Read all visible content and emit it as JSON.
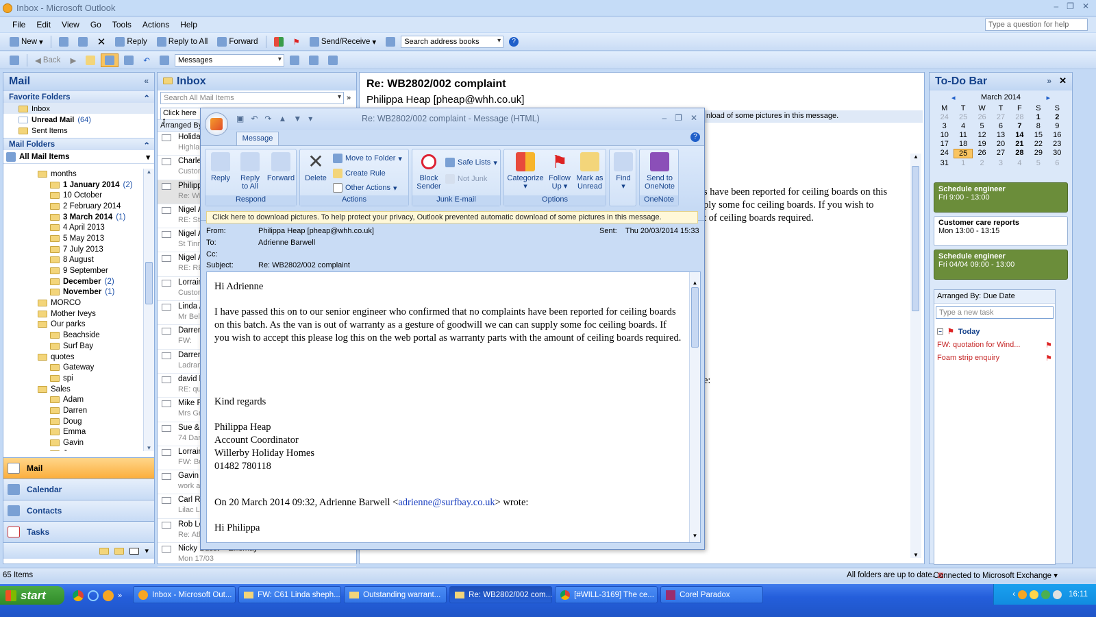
{
  "window": {
    "title": "Inbox - Microsoft Outlook",
    "help_placeholder": "Type a question for help"
  },
  "menu": [
    "File",
    "Edit",
    "View",
    "Go",
    "Tools",
    "Actions",
    "Help"
  ],
  "toolbar1": {
    "new": "New",
    "reply": "Reply",
    "reply_all": "Reply to All",
    "forward": "Forward",
    "send_receive": "Send/Receive",
    "search_address": "Search address books"
  },
  "toolbar2": {
    "back": "Back",
    "view_combo": "Messages"
  },
  "nav": {
    "title": "Mail",
    "favorites_header": "Favorite Folders",
    "favorites": [
      {
        "label": "Inbox",
        "count": ""
      },
      {
        "label": "Unread Mail",
        "count": "(64)"
      },
      {
        "label": "Sent Items",
        "count": ""
      }
    ],
    "mail_folders_header": "Mail Folders",
    "all_mail": "All Mail Items",
    "tree": [
      {
        "label": "months",
        "count": "",
        "indent": 1,
        "bold": false
      },
      {
        "label": "1 January 2014",
        "count": "(2)",
        "indent": 2,
        "bold": true
      },
      {
        "label": "10 October",
        "count": "",
        "indent": 2,
        "bold": false
      },
      {
        "label": "2 February 2014",
        "count": "",
        "indent": 2,
        "bold": false
      },
      {
        "label": "3 March 2014",
        "count": "(1)",
        "indent": 2,
        "bold": true
      },
      {
        "label": "4 April 2013",
        "count": "",
        "indent": 2,
        "bold": false
      },
      {
        "label": "5 May 2013",
        "count": "",
        "indent": 2,
        "bold": false
      },
      {
        "label": "7 July 2013",
        "count": "",
        "indent": 2,
        "bold": false
      },
      {
        "label": "8 August",
        "count": "",
        "indent": 2,
        "bold": false
      },
      {
        "label": "9 September",
        "count": "",
        "indent": 2,
        "bold": false
      },
      {
        "label": "December",
        "count": "(2)",
        "indent": 2,
        "bold": true
      },
      {
        "label": "November",
        "count": "(1)",
        "indent": 2,
        "bold": true
      },
      {
        "label": "MORCO",
        "count": "",
        "indent": 1,
        "bold": false
      },
      {
        "label": "Mother Iveys",
        "count": "",
        "indent": 1,
        "bold": false
      },
      {
        "label": "Our parks",
        "count": "",
        "indent": 1,
        "bold": false
      },
      {
        "label": "Beachside",
        "count": "",
        "indent": 2,
        "bold": false
      },
      {
        "label": "Surf Bay",
        "count": "",
        "indent": 2,
        "bold": false
      },
      {
        "label": "quotes",
        "count": "",
        "indent": 1,
        "bold": false
      },
      {
        "label": "Gateway",
        "count": "",
        "indent": 2,
        "bold": false
      },
      {
        "label": "spi",
        "count": "",
        "indent": 2,
        "bold": false
      },
      {
        "label": "Sales",
        "count": "",
        "indent": 1,
        "bold": false
      },
      {
        "label": "Adam",
        "count": "",
        "indent": 2,
        "bold": false
      },
      {
        "label": "Darren",
        "count": "",
        "indent": 2,
        "bold": false
      },
      {
        "label": "Doug",
        "count": "",
        "indent": 2,
        "bold": false
      },
      {
        "label": "Emma",
        "count": "",
        "indent": 2,
        "bold": false
      },
      {
        "label": "Gavin",
        "count": "",
        "indent": 2,
        "bold": false
      },
      {
        "label": "Jane",
        "count": "",
        "indent": 2,
        "bold": false
      }
    ],
    "buttons": [
      "Mail",
      "Calendar",
      "Contacts",
      "Tasks"
    ]
  },
  "inbox": {
    "title": "Inbox",
    "search_placeholder": "Search All Mail Items",
    "click_here": "Click here t",
    "arranged": "Arranged By",
    "items": [
      {
        "from": "Holiday",
        "sub": "Highlan"
      },
      {
        "from": "Charlen",
        "sub": "Custom"
      },
      {
        "from": "Philipp",
        "sub": "Re: WB"
      },
      {
        "from": "Nigel A",
        "sub": "RE: St T"
      },
      {
        "from": "Nigel A",
        "sub": "St Tinn"
      },
      {
        "from": "Nigel A",
        "sub": "RE: RE:"
      },
      {
        "from": "Lorrain",
        "sub": "Custom"
      },
      {
        "from": "Linda A",
        "sub": "Mr Bell"
      },
      {
        "from": "Darren",
        "sub": "FW:"
      },
      {
        "from": "Darren",
        "sub": "Ladram"
      },
      {
        "from": "david b",
        "sub": "RE: quo"
      },
      {
        "from": "Mike Fi",
        "sub": "Mrs Gri"
      },
      {
        "from": "Sue &P",
        "sub": "74 Dart"
      },
      {
        "from": "Lorrain",
        "sub": "FW: Bu"
      },
      {
        "from": "Gavin B",
        "sub": "work at"
      },
      {
        "from": "Carl Ro",
        "sub": "Lilac Lo"
      },
      {
        "from": "Rob Lo",
        "sub": "Re: Atla"
      },
      {
        "from": "Nicky Busst ~ Ellismay",
        "sub": "Mon 17/03"
      }
    ]
  },
  "reading": {
    "subject": "Re: WB2802/002 complaint",
    "from": "Philippa Heap [pheap@whh.co.uk]",
    "infobar": "nload of some pictures in this message.",
    "line1": "s have been reported for ceiling boards on this",
    "line2": "ply some foc ceiling boards.  If you wish to",
    "line3": "t of ceiling boards required.",
    "colon": "e:"
  },
  "todo": {
    "title": "To-Do Bar",
    "month": "March 2014",
    "days": [
      "M",
      "T",
      "W",
      "T",
      "F",
      "S",
      "S"
    ],
    "weeks": [
      [
        "24",
        "25",
        "26",
        "27",
        "28",
        "1",
        "2"
      ],
      [
        "3",
        "4",
        "5",
        "6",
        "7",
        "8",
        "9"
      ],
      [
        "10",
        "11",
        "12",
        "13",
        "14",
        "15",
        "16"
      ],
      [
        "17",
        "18",
        "19",
        "20",
        "21",
        "22",
        "23"
      ],
      [
        "24",
        "25",
        "26",
        "27",
        "28",
        "29",
        "30"
      ],
      [
        "31",
        "1",
        "2",
        "3",
        "4",
        "5",
        "6"
      ]
    ],
    "appts": [
      {
        "title": "Schedule engineer",
        "time": "Fri 9:00 - 13:00"
      },
      {
        "title": "Customer care reports",
        "time": "Mon 13:00 - 13:15"
      },
      {
        "title": "Schedule engineer",
        "time": "Fri 04/04 09:00 - 13:00"
      }
    ],
    "arranged": "Arranged By: Due Date",
    "new_task": "Type a new task",
    "today": "Today",
    "tasks": [
      "FW: quotation for Wind...",
      "Foam strip enquiry"
    ]
  },
  "message_window": {
    "title": "Re: WB2802/002 complaint - Message (HTML)",
    "tab": "Message",
    "respond": {
      "reply": "Reply",
      "reply_all_1": "Reply",
      "reply_all_2": "to All",
      "forward": "Forward",
      "label": "Respond"
    },
    "actions": {
      "delete": "Delete",
      "move": "Move to Folder",
      "rule": "Create Rule",
      "other": "Other Actions",
      "label": "Actions"
    },
    "junk": {
      "block_1": "Block",
      "block_2": "Sender",
      "safe": "Safe Lists",
      "not_junk": "Not Junk",
      "label": "Junk E-mail"
    },
    "options": {
      "categorize": "Categorize",
      "follow_1": "Follow",
      "follow_2": "Up",
      "mark_1": "Mark as",
      "mark_2": "Unread",
      "label": "Options"
    },
    "find": "Find",
    "onenote": {
      "send_1": "Send to",
      "send_2": "OneNote",
      "label": "OneNote"
    },
    "infobar": "Click here to download pictures. To help protect your privacy, Outlook prevented automatic download of some pictures in this message.",
    "from_label": "From:",
    "from": "Philippa Heap [pheap@whh.co.uk]",
    "to_label": "To:",
    "to": "Adrienne Barwell",
    "cc_label": "Cc:",
    "subject_label": "Subject:",
    "subject": "Re: WB2802/002 complaint",
    "sent_label": "Sent:",
    "sent": "Thu 20/03/2014 15:33",
    "body": {
      "greeting": "Hi Adrienne",
      "para": "I have passed this on to our senior engineer who confirmed that no complaints have been reported for ceiling boards on this batch.  As the van is out of warranty as a gesture of goodwill we can can supply some foc ceiling boards.  If you wish to accept this please log this on the web portal as warranty parts with the amount of ceiling boards required.",
      "regards": "Kind regards",
      "sig1": "Philippa Heap",
      "sig2": "Account Coordinator",
      "sig3": "Willerby Holiday Homes",
      "sig4": "01482 780118",
      "quote_pre": "On 20 March 2014 09:32, Adrienne Barwell <",
      "quote_link": "adrienne@surfbay.co.uk",
      "quote_post": "> wrote:",
      "cutoff": "Hi Philippa"
    }
  },
  "status": {
    "items": "65 Items",
    "updated": "All folders are up to date.",
    "exchange": "Connected to Microsoft Exchange ▾"
  },
  "taskbar": {
    "start": "start",
    "buttons": [
      "Inbox - Microsoft Out...",
      "FW: C61 Linda sheph...",
      "Outstanding warrant...",
      "Re: WB2802/002 com...",
      "[#WILL-3169] The ce...",
      "Corel Paradox"
    ],
    "clock": "16:11"
  }
}
